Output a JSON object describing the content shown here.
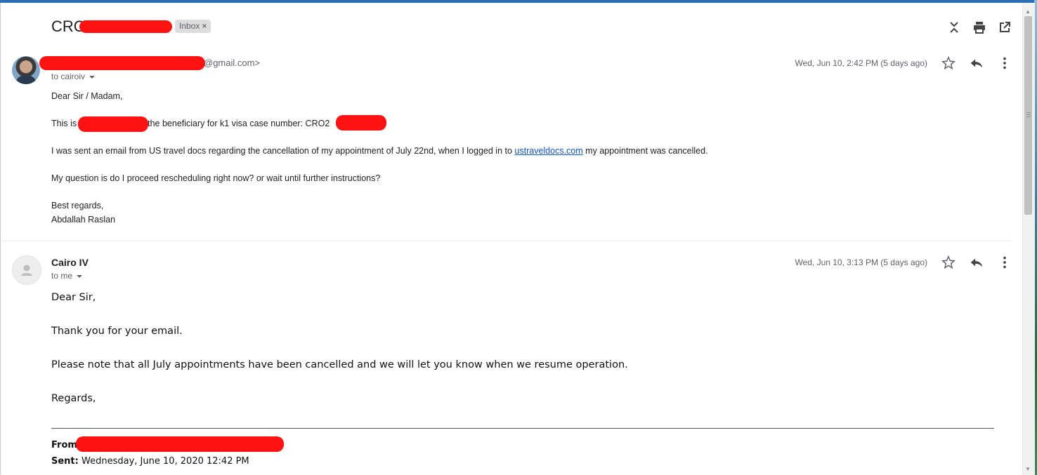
{
  "thread": {
    "subject": "CRO",
    "label": "Inbox",
    "label_remove": "×"
  },
  "icons": {
    "collapse": "collapse-all-icon",
    "print": "print-icon",
    "new_window": "open-new-window-icon",
    "star": "star-icon",
    "reply": "reply-icon",
    "more": "more-vertical-icon"
  },
  "message1": {
    "sender_email_suffix": "@gmail.com>",
    "to": "to cairoiv",
    "date": "Wed, Jun 10, 2:42 PM (5 days ago)",
    "greeting": "Dear Sir / Madam,",
    "line1_start": "This is",
    "line1_end": "the beneficiary for k1 visa case number: CRO2",
    "line2_start": "I was sent an email from US travel docs regarding the cancellation of my appointment of July 22nd, when I logged in to",
    "line2_link": "ustraveldocs.com",
    "line2_end": "my appointment was cancelled.",
    "line3": "My question is do I proceed rescheduling right now? or wait until further instructions?",
    "closing": "Best regards,",
    "signature": "Abdallah Raslan"
  },
  "message2": {
    "sender_name": "Cairo IV",
    "to": "to me",
    "date": "Wed, Jun 10, 3:13 PM (5 days ago)",
    "greeting": "Dear Sir,",
    "thanks": "Thank you for your email.",
    "note": "Please note that all July appointments have been cancelled and we will let you know when we resume operation.",
    "closing": "Regards,",
    "quoted_from_label": "From:",
    "quoted_sent_label": "Sent:",
    "quoted_sent_value": "Wednesday, June 10, 2020 12:42 PM"
  }
}
